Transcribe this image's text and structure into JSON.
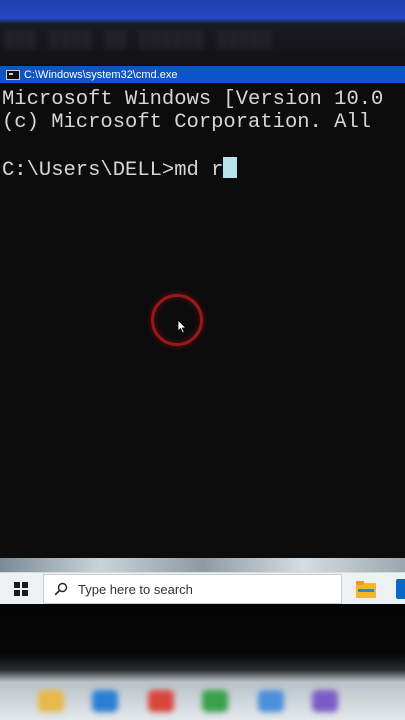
{
  "window": {
    "title": "C:\\Windows\\system32\\cmd.exe",
    "icon": "cmd-icon"
  },
  "console": {
    "lines": [
      "Microsoft Windows [Version 10.0",
      "(c) Microsoft Corporation. All",
      "",
      "C:\\Users\\DELL>md r"
    ],
    "colors": {
      "background": "#0c0c0c",
      "text": "#d6d6d6",
      "cursor": "#b8e3ee"
    }
  },
  "taskbar": {
    "start_icon": "windows-logo-icon",
    "search_placeholder": "Type here to search",
    "search_icon": "search-icon",
    "pinned": [
      "file-explorer-icon",
      "microsoft-store-icon"
    ],
    "accent": "#0a56c9"
  }
}
